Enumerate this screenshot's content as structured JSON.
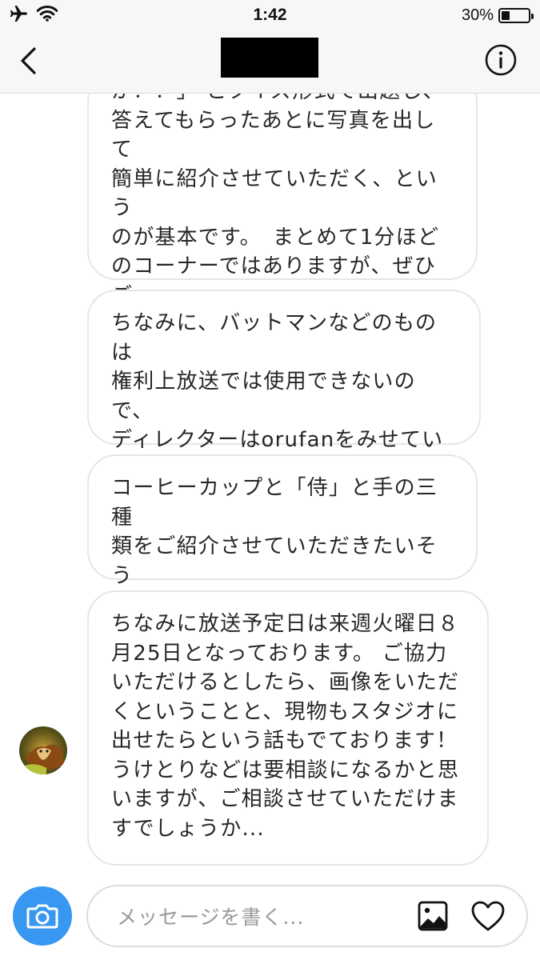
{
  "status_bar": {
    "time": "1:42",
    "battery_percent_label": "30%",
    "battery_level": 0.3,
    "icons": [
      "airplane-icon",
      "wifi-icon",
      "battery-icon"
    ]
  },
  "header": {
    "title_redacted": true,
    "back_icon": "chevron-left-icon",
    "info_icon": "info-icon"
  },
  "messages": [
    {
      "text": "か？？」 とクイズ形式で出題し、\n答えてもらったあとに写真を出して\n簡単に紹介させていただく、という\nのが基本です。　まとめて1分ほど\nのコーナーではありますが、ぜひご\n紹介できたらと思っております！"
    },
    {
      "text": "ちなみに、バットマンなどのものは\n権利上放送では使用できないので、\nディレクターはorufanをみせていた\nだいて、"
    },
    {
      "text": "コーヒーカップと「侍」と手の三種\n類をご紹介させていただきたいそう\nです！"
    },
    {
      "text": "ちなみに放送予定日は来週火曜日８\n月25日となっております。 ご協力\nいただけるとしたら、画像をいただ\nくということと、現物もスタジオに\n出せたらという話もでております！\nうけとりなどは要相談になるかと思\nいますが、ご相談させていただけま\nすでしょうか..."
    }
  ],
  "composer": {
    "placeholder": "メッセージを書く...",
    "value": "",
    "camera_icon": "camera-icon",
    "gallery_icon": "image-icon",
    "like_icon": "heart-icon"
  },
  "colors": {
    "accent": "#3897f0",
    "bubble_border": "#e6e6e6",
    "text": "#262626",
    "placeholder": "#999999"
  }
}
